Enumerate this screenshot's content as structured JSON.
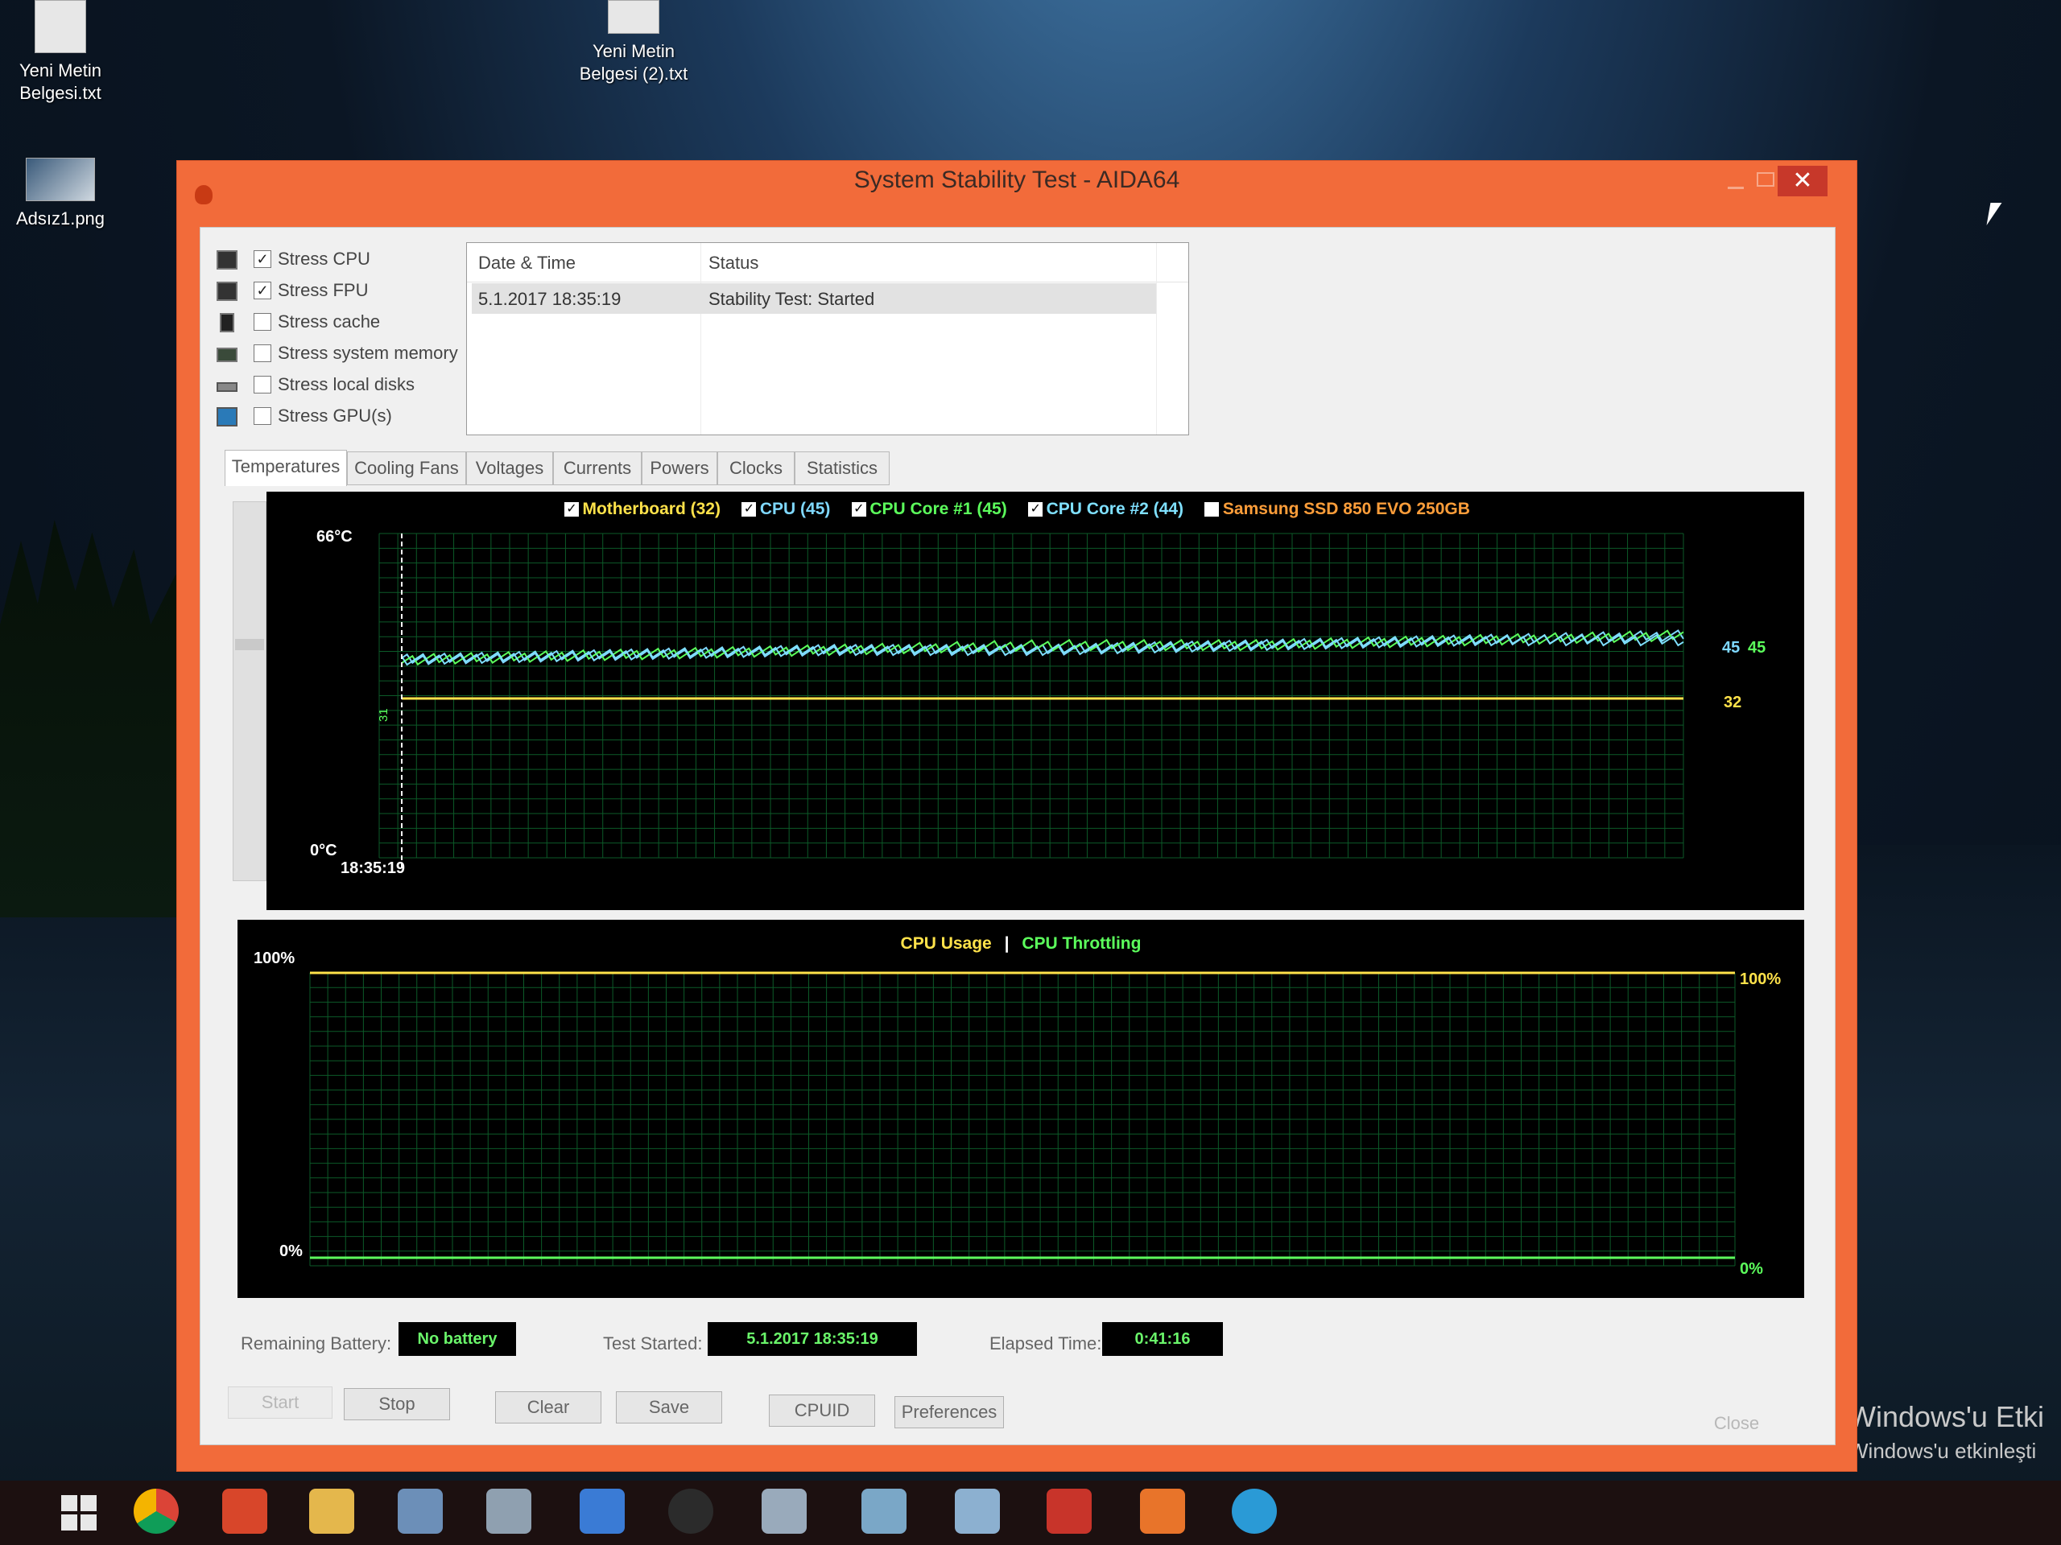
{
  "desktop": {
    "icons": [
      {
        "label_l1": "Yeni Metin",
        "label_l2": "Belgesi.txt"
      },
      {
        "label_l1": "Yeni Metin",
        "label_l2": "Belgesi (2).txt"
      },
      {
        "label_l1": "Adsız1.png",
        "label_l2": ""
      }
    ],
    "watermark": {
      "line1": "Windows'u Etki",
      "line2": "Windows'u etkinleşti"
    }
  },
  "window": {
    "title": "System Stability Test - AIDA64",
    "close_glyph": "✕"
  },
  "stress": {
    "items": [
      {
        "label": "Stress CPU",
        "checked": true
      },
      {
        "label": "Stress FPU",
        "checked": true
      },
      {
        "label": "Stress cache",
        "checked": false
      },
      {
        "label": "Stress system memory",
        "checked": false
      },
      {
        "label": "Stress local disks",
        "checked": false
      },
      {
        "label": "Stress GPU(s)",
        "checked": false
      }
    ]
  },
  "log": {
    "col_datetime": "Date & Time",
    "col_status": "Status",
    "rows": [
      {
        "datetime": "5.1.2017 18:35:19",
        "status": "Stability Test: Started"
      }
    ]
  },
  "tabs": [
    {
      "label": "Temperatures",
      "active": true
    },
    {
      "label": "Cooling Fans",
      "active": false
    },
    {
      "label": "Voltages",
      "active": false
    },
    {
      "label": "Currents",
      "active": false
    },
    {
      "label": "Powers",
      "active": false
    },
    {
      "label": "Clocks",
      "active": false
    },
    {
      "label": "Statistics",
      "active": false
    }
  ],
  "temp_graph": {
    "legend": [
      {
        "label": "Motherboard (32)",
        "checked": true,
        "color": "#ffe24a"
      },
      {
        "label": "CPU (45)",
        "checked": true,
        "color": "#7fd8ff"
      },
      {
        "label": "CPU Core #1 (45)",
        "checked": true,
        "color": "#5cff5c"
      },
      {
        "label": "CPU Core #2 (44)",
        "checked": true,
        "color": "#7fe0ff"
      },
      {
        "label": "Samsung SSD 850 EVO 250GB",
        "checked": false,
        "color": "#ff9e3a"
      }
    ],
    "y_max_label": "66°C",
    "y_min_label": "0°C",
    "start_time": "18:35:19",
    "end_labels": [
      "45",
      "45",
      "32"
    ],
    "mini_label": "31"
  },
  "usage_graph": {
    "title_usage": "CPU Usage",
    "separator": "|",
    "title_throttle": "CPU Throttling",
    "y_max_label": "100%",
    "y_min_label": "0%",
    "end_top": "100%",
    "end_bottom": "0%",
    "colors": {
      "usage": "#ffe24a",
      "throttle": "#5cff5c"
    }
  },
  "status": {
    "battery_label": "Remaining Battery:",
    "battery_value": "No battery",
    "started_label": "Test Started:",
    "started_value": "5.1.2017 18:35:19",
    "elapsed_label": "Elapsed Time:",
    "elapsed_value": "0:41:16"
  },
  "buttons": {
    "start": "Start",
    "stop": "Stop",
    "clear": "Clear",
    "save": "Save",
    "cpuid": "CPUID",
    "preferences": "Preferences",
    "close": "Close"
  },
  "chart_data": [
    {
      "type": "line",
      "ylim": [
        0,
        66
      ],
      "ylabel": "°C",
      "series": [
        {
          "name": "Motherboard",
          "values": [
            32,
            32,
            32,
            32,
            32,
            32,
            32
          ]
        },
        {
          "name": "CPU",
          "values": [
            40,
            41,
            42,
            42,
            43,
            44,
            45
          ]
        },
        {
          "name": "CPU Core #1",
          "values": [
            40,
            41,
            42,
            43,
            43,
            44,
            45
          ]
        },
        {
          "name": "CPU Core #2",
          "values": [
            40,
            41,
            42,
            42,
            43,
            44,
            44
          ]
        }
      ]
    },
    {
      "type": "line",
      "ylim": [
        0,
        100
      ],
      "series": [
        {
          "name": "CPU Usage",
          "values": [
            100,
            100,
            100,
            100,
            100,
            100,
            100
          ]
        },
        {
          "name": "CPU Throttling",
          "values": [
            0,
            0,
            0,
            0,
            0,
            0,
            0
          ]
        }
      ]
    }
  ]
}
